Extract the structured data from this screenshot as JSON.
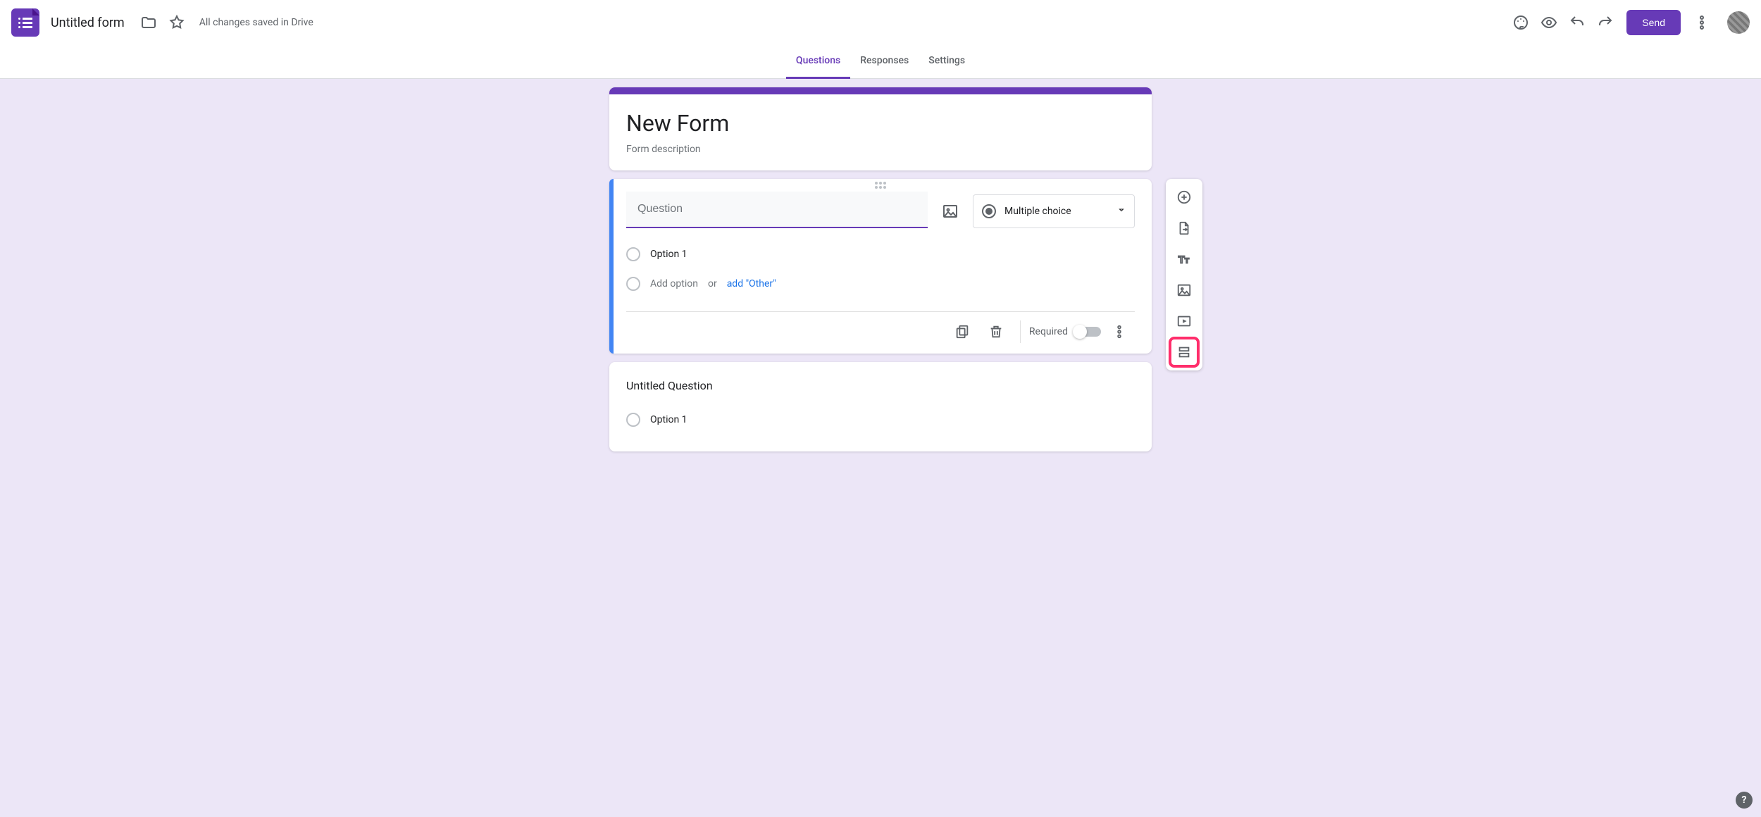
{
  "header": {
    "doc_title": "Untitled form",
    "save_status": "All changes saved in Drive",
    "send_label": "Send"
  },
  "tabs": {
    "questions": "Questions",
    "responses": "Responses",
    "settings": "Settings"
  },
  "title_card": {
    "form_title": "New Form",
    "form_description": "Form description"
  },
  "question_card": {
    "question_placeholder": "Question",
    "question_value": "",
    "type_label": "Multiple choice",
    "option1": "Option 1",
    "add_option": "Add option",
    "or": "or",
    "add_other": "add \"Other\"",
    "required_label": "Required"
  },
  "question2": {
    "title": "Untitled Question",
    "option1": "Option 1"
  },
  "toolbar_icons": {
    "add_question": "add-question",
    "import_questions": "import-questions",
    "add_title": "add-title-description",
    "add_image": "add-image",
    "add_video": "add-video",
    "add_section": "add-section"
  }
}
